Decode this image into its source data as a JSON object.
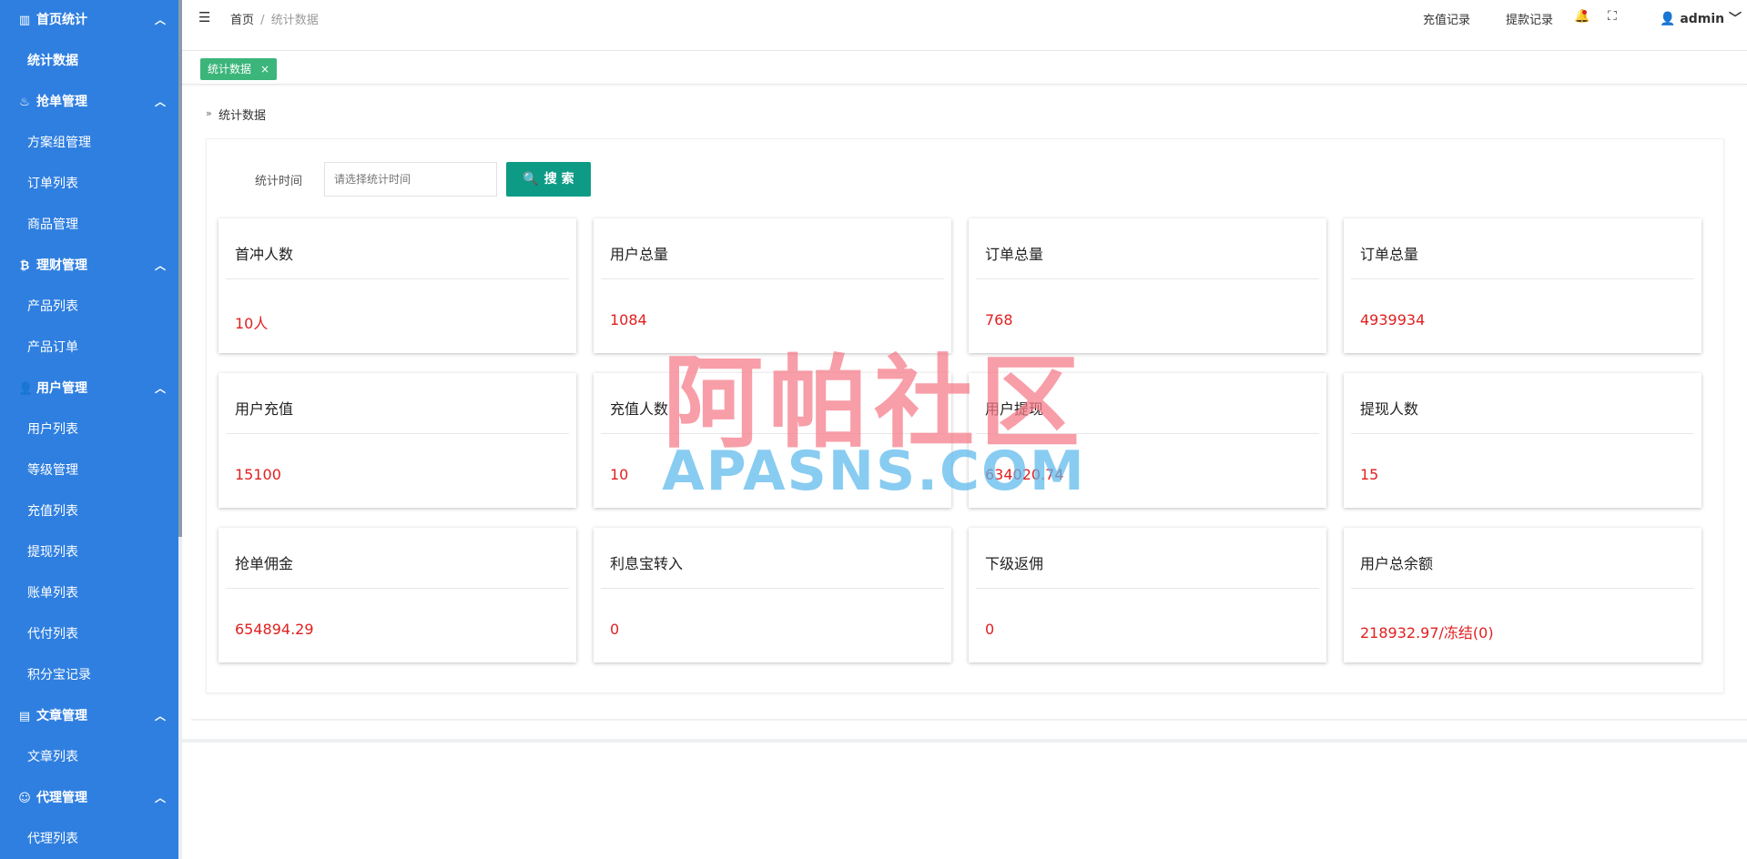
{
  "sidebar": {
    "groups": [
      {
        "label": "首页统计",
        "icon": "bar-chart-icon",
        "children": [
          "统计数据"
        ]
      },
      {
        "label": "抢单管理",
        "icon": "fire-icon",
        "children": [
          "方案组管理",
          "订单列表",
          "商品管理"
        ]
      },
      {
        "label": "理财管理",
        "icon": "bitcoin-icon",
        "children": [
          "产品列表",
          "产品订单"
        ]
      },
      {
        "label": "用户管理",
        "icon": "user-icon",
        "children": [
          "用户列表",
          "等级管理",
          "充值列表",
          "提现列表",
          "账单列表",
          "代付列表",
          "积分宝记录"
        ]
      },
      {
        "label": "文章管理",
        "icon": "document-icon",
        "children": [
          "文章列表"
        ]
      },
      {
        "label": "代理管理",
        "icon": "agent-icon",
        "children": [
          "代理列表"
        ]
      }
    ],
    "active": "统计数据"
  },
  "header": {
    "breadcrumb_home": "首页",
    "breadcrumb_sep": "/",
    "breadcrumb_current": "统计数据",
    "recharge_link": "充值记录",
    "withdraw_link": "提款记录",
    "user_name": "admin"
  },
  "tabs": [
    {
      "label": "统计数据",
      "close": "×"
    }
  ],
  "page": {
    "title": "统计数据",
    "filter_label": "统计时间",
    "filter_placeholder": "请选择统计时间",
    "search_label": "搜 索"
  },
  "stats": [
    {
      "title": "首冲人数",
      "value": "10人"
    },
    {
      "title": "用户总量",
      "value": "1084"
    },
    {
      "title": "订单总量",
      "value": "768"
    },
    {
      "title": "订单总量",
      "value": "4939934"
    },
    {
      "title": "用户充值",
      "value": "15100"
    },
    {
      "title": "充值人数",
      "value": "10"
    },
    {
      "title": "用户提现",
      "value": "634020.74"
    },
    {
      "title": "提现人数",
      "value": "15"
    },
    {
      "title": "抢单佣金",
      "value": "654894.29"
    },
    {
      "title": "利息宝转入",
      "value": "0"
    },
    {
      "title": "下级返佣",
      "value": "0"
    },
    {
      "title": "用户总余额",
      "value": "218932.97/冻结(0)"
    }
  ],
  "watermark": {
    "cn": "阿帕社区",
    "en": "APASNS.COM"
  },
  "colors": {
    "sidebar": "#2f7fe0",
    "tab": "#3bb57a",
    "button": "#0e9b86",
    "value": "#e02020"
  }
}
